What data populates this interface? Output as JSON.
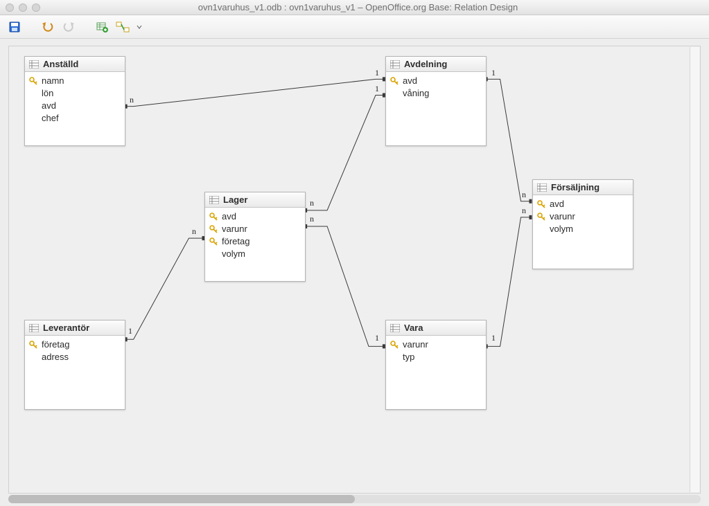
{
  "window": {
    "title": "ovn1varuhus_v1.odb : ovn1varuhus_v1 – OpenOffice.org Base: Relation Design"
  },
  "toolbar": {
    "icons": [
      "save-icon",
      "undo-icon",
      "redo-icon",
      "add-table-icon",
      "add-relation-icon",
      "dropdown-icon"
    ]
  },
  "tables": {
    "anstalld": {
      "title": "Anställd",
      "fields": [
        {
          "name": "namn",
          "key": true
        },
        {
          "name": "lön",
          "key": false
        },
        {
          "name": "avd",
          "key": false
        },
        {
          "name": "chef",
          "key": false
        }
      ]
    },
    "avdelning": {
      "title": "Avdelning",
      "fields": [
        {
          "name": "avd",
          "key": true
        },
        {
          "name": "våning",
          "key": false
        }
      ]
    },
    "lager": {
      "title": "Lager",
      "fields": [
        {
          "name": "avd",
          "key": true
        },
        {
          "name": "varunr",
          "key": true
        },
        {
          "name": "företag",
          "key": true
        },
        {
          "name": "volym",
          "key": false
        }
      ]
    },
    "forsaljning": {
      "title": "Försäljning",
      "fields": [
        {
          "name": "avd",
          "key": true
        },
        {
          "name": "varunr",
          "key": true
        },
        {
          "name": "volym",
          "key": false
        }
      ]
    },
    "leverantor": {
      "title": "Leverantör",
      "fields": [
        {
          "name": "företag",
          "key": true
        },
        {
          "name": "adress",
          "key": false
        }
      ]
    },
    "vara": {
      "title": "Vara",
      "fields": [
        {
          "name": "varunr",
          "key": true
        },
        {
          "name": "typ",
          "key": false
        }
      ]
    }
  },
  "relations": [
    {
      "from": "anstalld",
      "to": "avdelning",
      "from_card": "n",
      "to_card": "1"
    },
    {
      "from": "lager",
      "to": "avdelning",
      "from_card": "n",
      "to_card": "1"
    },
    {
      "from": "lager",
      "to": "leverantor",
      "from_card": "n",
      "to_card": "1"
    },
    {
      "from": "lager",
      "to": "vara",
      "from_card": "n",
      "to_card": "1"
    },
    {
      "from": "forsaljning",
      "to": "avdelning",
      "from_card": "n",
      "to_card": "1"
    },
    {
      "from": "forsaljning",
      "to": "vara",
      "from_card": "n",
      "to_card": "1"
    }
  ]
}
